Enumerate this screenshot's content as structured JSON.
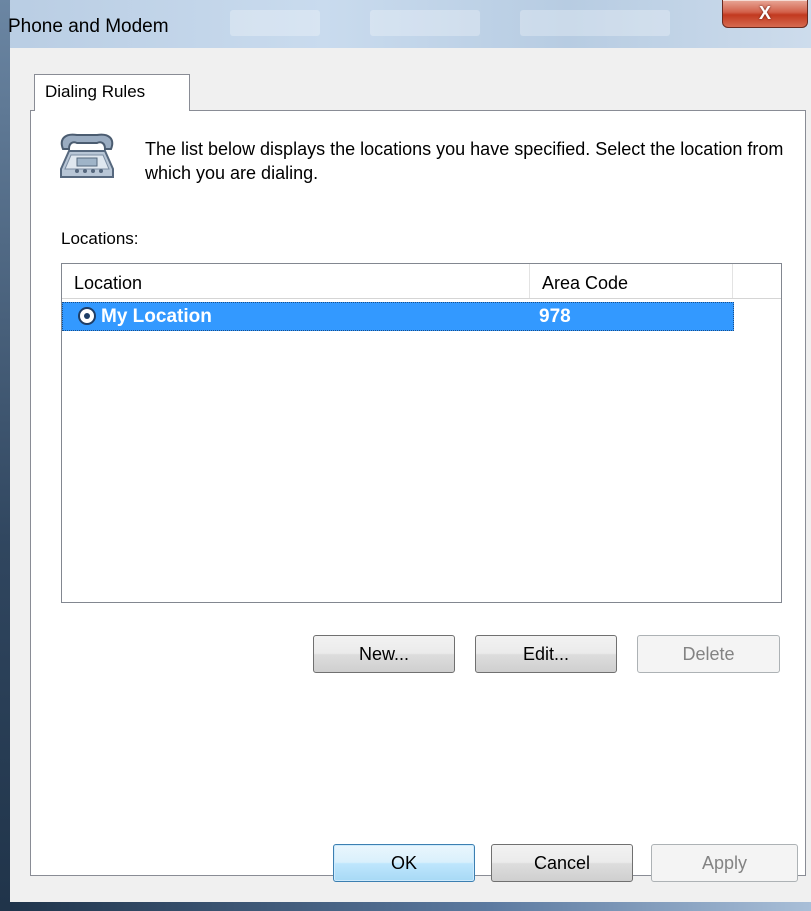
{
  "window": {
    "title": "Phone and Modem",
    "close_glyph": "X"
  },
  "tabs": [
    {
      "label": "Dialing Rules"
    }
  ],
  "dialing_rules": {
    "icon": "telephone-icon",
    "description": "The list below displays the locations you have specified. Select the location from which you are dialing.",
    "locations_label": "Locations:",
    "columns": [
      "Location",
      "Area Code"
    ],
    "rows": [
      {
        "location": "My Location",
        "area_code": "978",
        "selected": true
      }
    ],
    "buttons": {
      "new": "New...",
      "edit": "Edit...",
      "delete": "Delete"
    }
  },
  "footer": {
    "ok": "OK",
    "cancel": "Cancel",
    "apply": "Apply"
  },
  "colors": {
    "selection": "#3399ff",
    "close_button": "#c23a20"
  }
}
